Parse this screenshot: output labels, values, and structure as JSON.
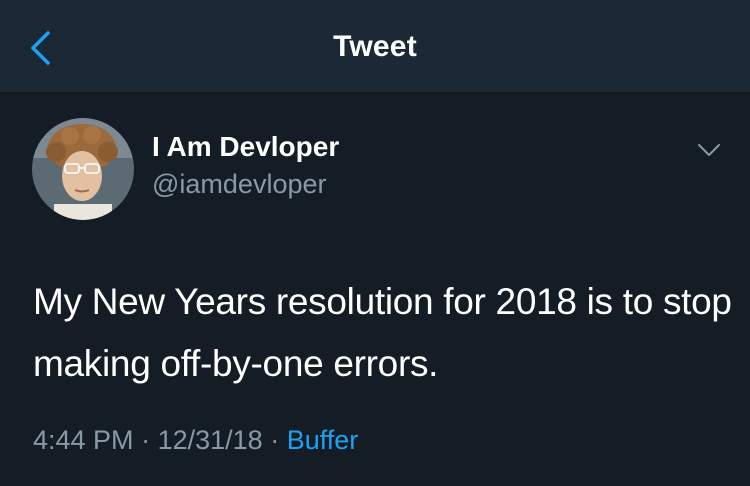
{
  "header": {
    "title": "Tweet",
    "back_icon": "chevron-left-icon"
  },
  "tweet": {
    "author": {
      "display_name": "I Am Devloper",
      "handle": "@iamdevloper"
    },
    "text": "My New Years resolution for 2018 is to stop making off-by-one errors.",
    "time": "4:44 PM",
    "date": "12/31/18",
    "separator": "·",
    "source": "Buffer",
    "menu_icon": "chevron-down-icon"
  },
  "colors": {
    "background": "#141d26",
    "navbar": "#1b2836",
    "accent": "#1da1f2",
    "secondary_text": "#8899a6"
  }
}
